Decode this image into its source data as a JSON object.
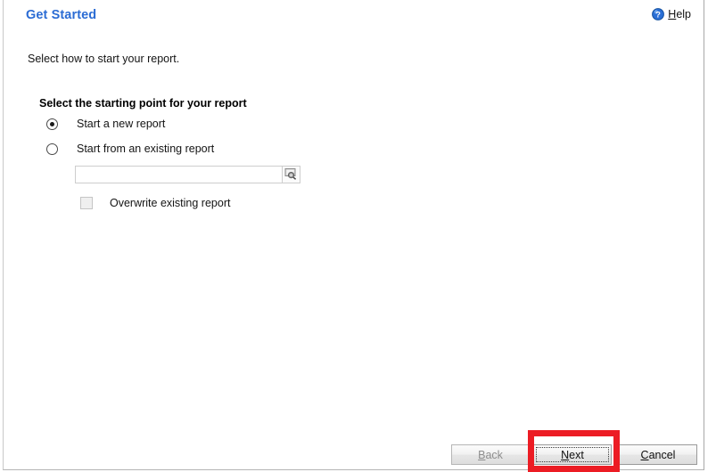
{
  "window": {
    "title": "Get Started",
    "subtitle": "Select how to start your report."
  },
  "help": {
    "label_accel": "H",
    "label_rest": "elp",
    "icon": "help-circle-icon",
    "icon_color": "#2a6fd6"
  },
  "group": {
    "title": "Select the starting point for your report",
    "options": [
      {
        "label": "Start a new report",
        "selected": true
      },
      {
        "label": "Start from an existing report",
        "selected": false
      }
    ]
  },
  "existing_report": {
    "value": "",
    "placeholder": "",
    "browse_icon": "browse-search-icon",
    "enabled": false
  },
  "overwrite": {
    "label": "Overwrite existing report",
    "checked": false,
    "enabled": false
  },
  "footer": {
    "back": {
      "accel": "B",
      "rest": "ack",
      "enabled": false
    },
    "next": {
      "accel": "N",
      "rest": "ext",
      "enabled": true,
      "focused": true
    },
    "cancel": {
      "accel": "C",
      "rest": "ancel",
      "enabled": true
    }
  },
  "annotation": {
    "target": "next-button",
    "color": "#ec1c24"
  }
}
